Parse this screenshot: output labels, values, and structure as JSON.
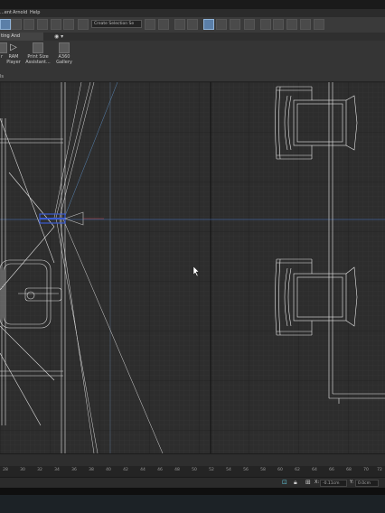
{
  "menubar": {
    "items": [
      "...ent",
      "Arnold",
      "Help"
    ]
  },
  "toolbar": {
    "selection_set_placeholder": "Create Selection Se",
    "icons": [
      "select-icon",
      "select-region-icon",
      "rotate-icon",
      "scale-icon",
      "percent-snap-icon",
      "spinner-snap-icon",
      "named-selection-icon",
      "mirror-icon",
      "align-icon",
      "layer-manager-icon",
      "toggle-ribbon-icon",
      "curve-editor-icon",
      "schematic-view-icon",
      "material-editor-icon",
      "render-setup-icon",
      "rendered-frame-icon",
      "render-icon",
      "render-iterative-icon"
    ]
  },
  "ribbon": {
    "tab_label": "ting And Rendering",
    "buttons": [
      {
        "label": "r",
        "icon": "render-icon"
      },
      {
        "label": "RAM\nPlayer",
        "icon": "play-icon"
      },
      {
        "label": "Print Size\nAssistant...",
        "icon": "printer-icon"
      },
      {
        "label": "A360\nGallery",
        "icon": "gallery-icon"
      }
    ],
    "panel_label": "ls"
  },
  "ruler": {
    "ticks": [
      "28",
      "30",
      "32",
      "34",
      "36",
      "38",
      "40",
      "42",
      "44",
      "46",
      "48",
      "50",
      "52",
      "54",
      "56",
      "58",
      "60",
      "62",
      "64",
      "66",
      "68",
      "70",
      "72"
    ]
  },
  "status": {
    "x_label": "X:",
    "x_value": "-0.11cm",
    "y_label": "Y:",
    "y_value": "0.0cm"
  },
  "colors": {
    "grid_minor": "#3a3a3a",
    "grid_major": "#1f1f1f",
    "wire": "#e6e6e6",
    "axis_blue": "#4a78c8",
    "selected_blue": "#3a5ad0",
    "taskbar": "#1c2226"
  }
}
